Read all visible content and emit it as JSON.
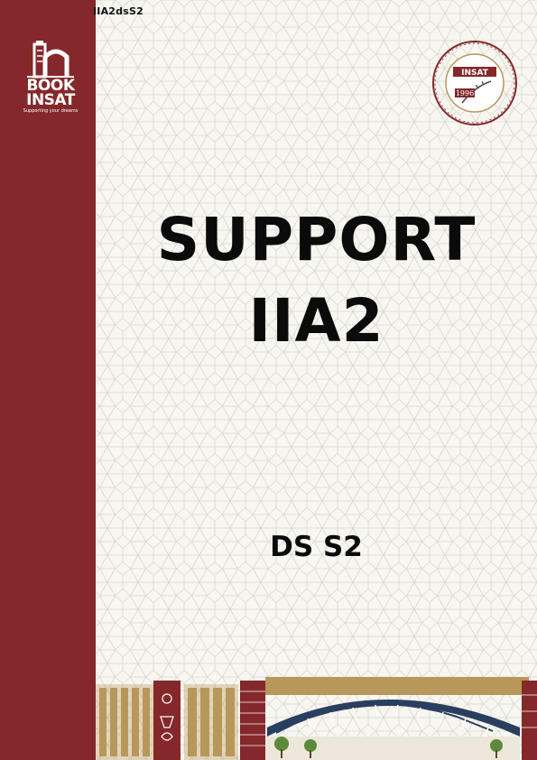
{
  "document": {
    "code": "IIA2dsS2",
    "title_line1": "SUPPORT",
    "title_line2": "IIA2",
    "subtitle": "DS S2"
  },
  "book_logo": {
    "word1": "BOOK",
    "word2": "INSAT",
    "tagline": "Supporting your dreams"
  },
  "seal": {
    "acronym": "INSAT",
    "year": "1996"
  },
  "colors": {
    "sidebar": "#85282b",
    "background": "#f7f6f1",
    "gold": "#b8975a",
    "text": "#0b0b0b"
  }
}
